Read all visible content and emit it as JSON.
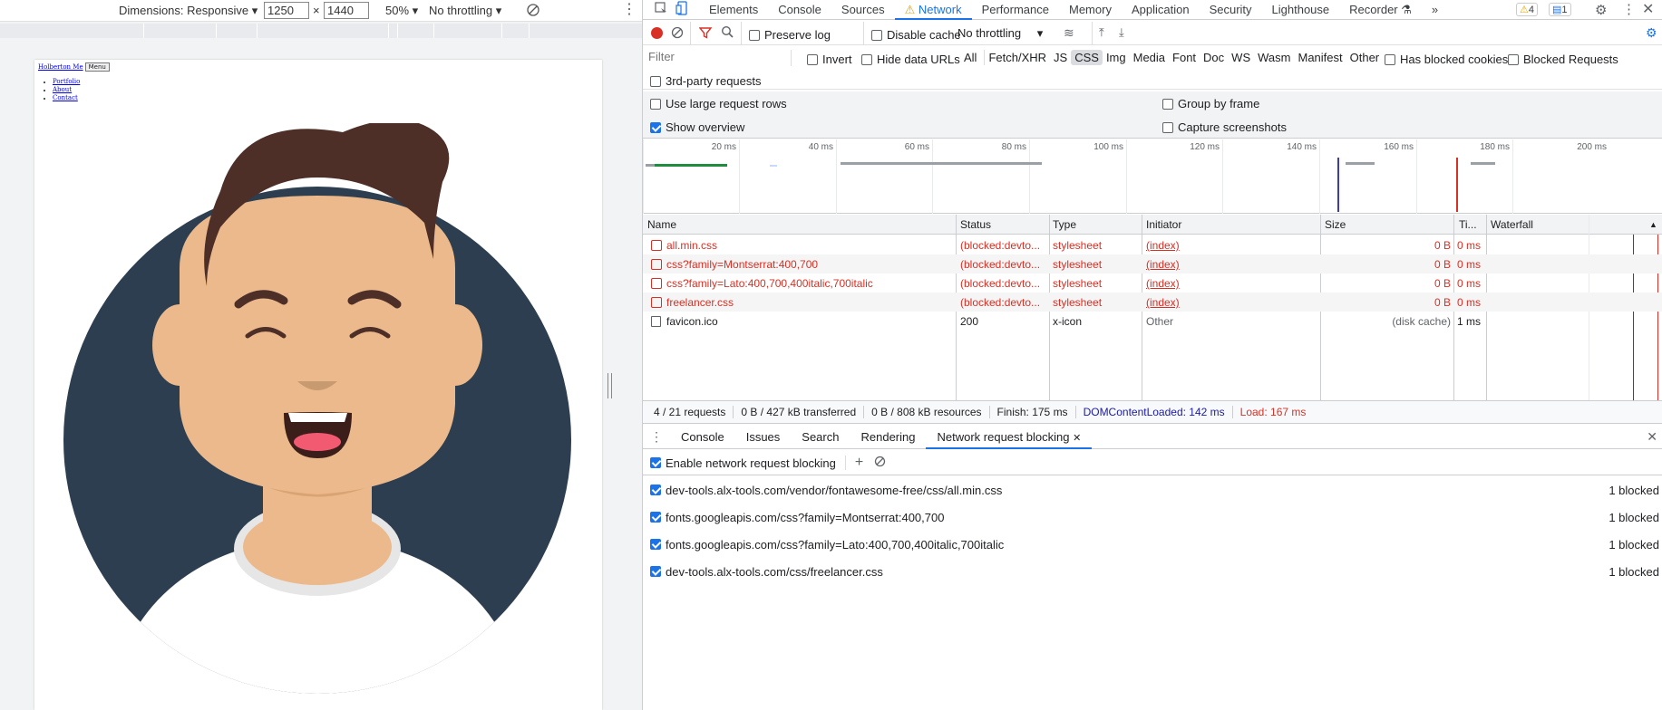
{
  "device_toolbar": {
    "dimensions_label": "Dimensions: Responsive",
    "width": "1250",
    "times": "×",
    "height": "1440",
    "zoom": "50%",
    "throttling": "No throttling"
  },
  "preview": {
    "brand_link": "Holberton Me",
    "menu_button": "Menu",
    "nav_links": [
      "Portfolio",
      "About",
      "Contact"
    ]
  },
  "devtools": {
    "tabs": [
      "Elements",
      "Console",
      "Sources",
      "Network",
      "Performance",
      "Memory",
      "Application",
      "Security",
      "Lighthouse",
      "Recorder",
      "»"
    ],
    "selected_tab": "Network",
    "warning_count": "4",
    "message_count": "1",
    "toolbar": {
      "preserve_log": "Preserve log",
      "disable_cache": "Disable cache",
      "throttling": "No throttling"
    },
    "filter": {
      "placeholder": "Filter",
      "invert": "Invert",
      "hide_data_urls": "Hide data URLs",
      "types": [
        "All",
        "Fetch/XHR",
        "JS",
        "CSS",
        "Img",
        "Media",
        "Font",
        "Doc",
        "WS",
        "Wasm",
        "Manifest",
        "Other"
      ],
      "selected_type": "CSS",
      "has_blocked_cookies": "Has blocked cookies",
      "blocked_requests": "Blocked Requests",
      "third_party": "3rd-party requests"
    },
    "options": {
      "large_rows": "Use large request rows",
      "group_by_frame": "Group by frame",
      "show_overview": "Show overview",
      "capture_screenshots": "Capture screenshots"
    },
    "timeline_ticks": [
      "20 ms",
      "40 ms",
      "60 ms",
      "80 ms",
      "100 ms",
      "120 ms",
      "140 ms",
      "160 ms",
      "180 ms",
      "200 ms"
    ],
    "columns": [
      "Name",
      "Status",
      "Type",
      "Initiator",
      "Size",
      "Ti...",
      "Waterfall"
    ],
    "requests": [
      {
        "name": "all.min.css",
        "status": "(blocked:devto...",
        "type": "stylesheet",
        "initiator": "(index)",
        "size": "0 B",
        "time": "0 ms",
        "blocked": true
      },
      {
        "name": "css?family=Montserrat:400,700",
        "status": "(blocked:devto...",
        "type": "stylesheet",
        "initiator": "(index)",
        "size": "0 B",
        "time": "0 ms",
        "blocked": true
      },
      {
        "name": "css?family=Lato:400,700,400italic,700italic",
        "status": "(blocked:devto...",
        "type": "stylesheet",
        "initiator": "(index)",
        "size": "0 B",
        "time": "0 ms",
        "blocked": true
      },
      {
        "name": "freelancer.css",
        "status": "(blocked:devto...",
        "type": "stylesheet",
        "initiator": "(index)",
        "size": "0 B",
        "time": "0 ms",
        "blocked": true
      },
      {
        "name": "favicon.ico",
        "status": "200",
        "type": "x-icon",
        "initiator": "Other",
        "size": "(disk cache)",
        "time": "1 ms",
        "blocked": false
      }
    ],
    "summary": {
      "requests": "4 / 21 requests",
      "transferred": "0 B / 427 kB transferred",
      "resources": "0 B / 808 kB resources",
      "finish": "Finish: 175 ms",
      "dcl": "DOMContentLoaded: 142 ms",
      "load": "Load: 167 ms"
    },
    "drawer": {
      "tabs": [
        "Console",
        "Issues",
        "Search",
        "Rendering",
        "Network request blocking"
      ],
      "selected": "Network request blocking",
      "enable_label": "Enable network request blocking",
      "patterns": [
        {
          "url": "dev-tools.alx-tools.com/vendor/fontawesome-free/css/all.min.css",
          "count": "1 blocked"
        },
        {
          "url": "fonts.googleapis.com/css?family=Montserrat:400,700",
          "count": "1 blocked"
        },
        {
          "url": "fonts.googleapis.com/css?family=Lato:400,700,400italic,700italic",
          "count": "1 blocked"
        },
        {
          "url": "dev-tools.alx-tools.com/css/freelancer.css",
          "count": "1 blocked"
        }
      ]
    }
  },
  "colors": {
    "accent": "#1a73e8",
    "error": "#d93025",
    "avatar_bg": "#2c3e50",
    "skin": "#ebb98b",
    "hair": "#4d2f28"
  }
}
